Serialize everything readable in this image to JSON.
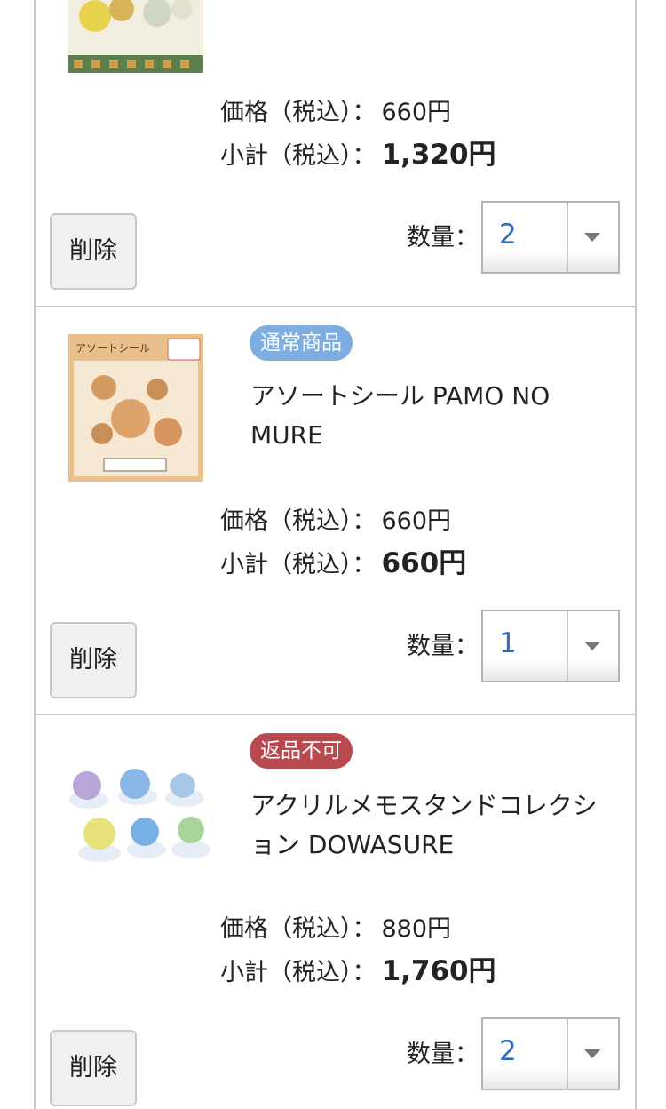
{
  "labels": {
    "price": "価格（税込）：",
    "subtotal": "小計（税込）：",
    "delete": "削除",
    "quantity": "数量："
  },
  "items": [
    {
      "price": "660円",
      "subtotal": "1,320円",
      "quantity": "2"
    },
    {
      "badge": "通常商品",
      "badge_color": "#7eaee1",
      "title": "アソートシール PAMO NO MURE",
      "thumb_text": "アソートシール",
      "price": "660円",
      "subtotal": "660円",
      "quantity": "1"
    },
    {
      "badge": "返品不可",
      "badge_color": "#b8494f",
      "title": "アクリルメモスタンドコレクション DOWASURE",
      "price": "880円",
      "subtotal": "1,760円",
      "quantity": "2"
    }
  ],
  "colors": {
    "border": "#c9c9c9",
    "quantity_value": "#2d6bc0"
  }
}
